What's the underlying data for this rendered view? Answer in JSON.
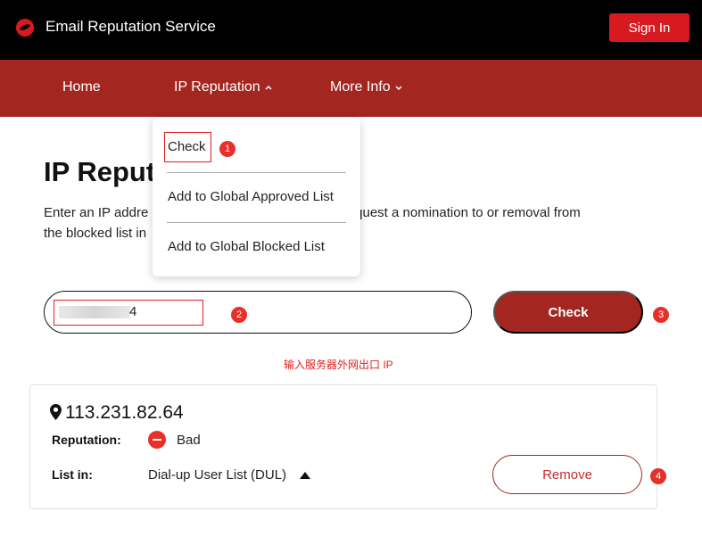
{
  "header": {
    "app_title": "Email Reputation Service",
    "sign_in_label": "Sign In",
    "logo_icon": "trend-micro-logo-icon"
  },
  "nav": {
    "items": [
      {
        "label": "Home",
        "icon": ""
      },
      {
        "label": "IP Reputation",
        "icon": "chevron-up-icon"
      },
      {
        "label": "More Info",
        "icon": "chevron-down-icon"
      }
    ]
  },
  "dropdown": {
    "items": [
      {
        "label": "Check"
      },
      {
        "label": "Add to Global Approved List"
      },
      {
        "label": "Add to Global Blocked List"
      }
    ]
  },
  "main": {
    "title": "IP Reput",
    "description_line1": "Enter an IP addre",
    "description_line1_right": "may request a nomination to or removal from",
    "description_line2": "the blocked list in"
  },
  "search": {
    "input_visible_tail": "4",
    "check_label": "Check",
    "hint": "输入服务器外网出口 IP"
  },
  "result": {
    "ip": "113.231.82.64",
    "reputation_label": "Reputation:",
    "reputation_value": "Bad",
    "list_label": "List in:",
    "list_value": "Dial-up User List (DUL)",
    "remove_label": "Remove"
  },
  "annotations": {
    "badges": [
      "1",
      "2",
      "3",
      "4"
    ],
    "color": "#e02020"
  },
  "colors": {
    "brand_red": "#d71920",
    "nav_red": "#a32620",
    "topbar": "#000000"
  }
}
